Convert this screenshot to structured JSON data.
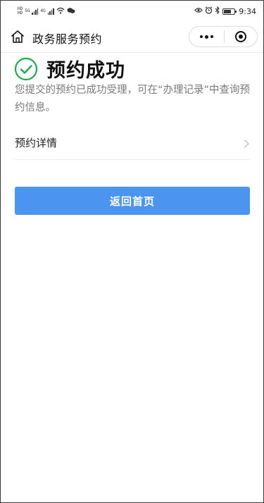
{
  "status_bar": {
    "left_glyphs": [
      "HD",
      "5G",
      "4G"
    ],
    "signal_levels": [
      4,
      4
    ],
    "time": "9:34",
    "battery_level": 0.7
  },
  "nav": {
    "title": "政务服务预约",
    "home_icon": "home-icon",
    "more_icon": "more-dots-icon",
    "close_icon": "target-close-icon"
  },
  "result": {
    "title": "预约成功",
    "description": "您提交的预约已成功受理，可在“办理记录”中查询预约信息。",
    "icon": "check-circle-icon",
    "icon_color": "#1aad4b"
  },
  "detail": {
    "label": "预约详情",
    "chevron": "chevron-right-icon"
  },
  "actions": {
    "home_button_label": "返回首页",
    "button_color": "#4b94f0"
  }
}
